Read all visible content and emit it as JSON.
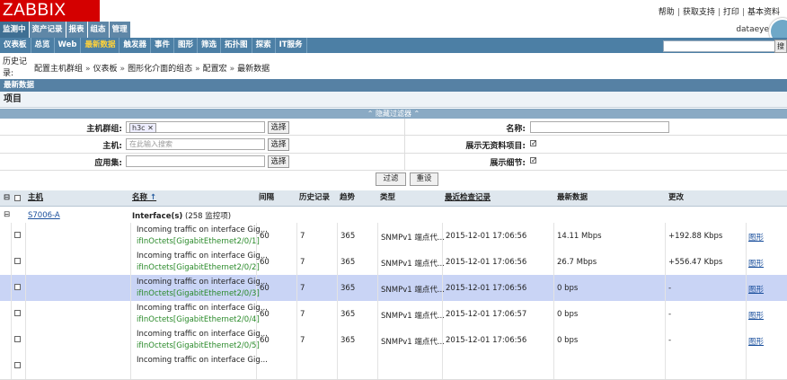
{
  "header": {
    "logo": "ZABBIX",
    "links": [
      "帮助",
      "获取支持",
      "打印",
      "基本资料"
    ],
    "user": "dataeye"
  },
  "main_tabs": [
    {
      "label": "监测中",
      "active": true
    },
    {
      "label": "资产记录"
    },
    {
      "label": "报表"
    },
    {
      "label": "组态"
    },
    {
      "label": "管理"
    }
  ],
  "sub_tabs": [
    {
      "label": "仪表板"
    },
    {
      "label": "总览"
    },
    {
      "label": "Web"
    },
    {
      "label": "最新数据",
      "active": true
    },
    {
      "label": "触发器"
    },
    {
      "label": "事件"
    },
    {
      "label": "图形"
    },
    {
      "label": "筛选"
    },
    {
      "label": "拓扑图"
    },
    {
      "label": "探索"
    },
    {
      "label": "IT服务"
    }
  ],
  "search": {
    "button": "搜"
  },
  "history": {
    "label": "历史记录:",
    "crumbs": [
      "配置主机群组",
      "仪表板",
      "图形化介面的组态",
      "配置宏",
      "最新数据"
    ]
  },
  "section_title": "最新数据",
  "items_title": "项目",
  "filter": {
    "toggle_label": "隐藏过滤器",
    "host_group_label": "主机群组:",
    "host_group_tag": "h3c",
    "host_label": "主机:",
    "host_placeholder": "在此输入搜索",
    "app_label": "应用集:",
    "select_btn": "选择",
    "name_label": "名称:",
    "show_no_data_label": "展示无资料项目:",
    "show_details_label": "展示细节:",
    "filter_btn": "过滤",
    "reset_btn": "重设"
  },
  "table": {
    "columns": [
      "主机",
      "名称",
      "间隔",
      "历史记录",
      "趋势",
      "类型",
      "最近检查记录",
      "最新数据",
      "更改"
    ],
    "sort_arrow": "↑",
    "group_host": "S7006-A",
    "group_name": "Interface(s)",
    "group_count": "(258 监控项)",
    "rows": [
      {
        "name": "Incoming traffic on interface Gig...",
        "key": "ifInOctets[GigabitEthernet2/0/1]",
        "interval": "60",
        "history": "7",
        "trends": "365",
        "type": "SNMPv1 端点代...",
        "last_check": "2015-12-01 17:06:56",
        "last_value": "14.11 Mbps",
        "change": "+192.88 Kbps",
        "graph": "图形"
      },
      {
        "name": "Incoming traffic on interface Gig...",
        "key": "ifInOctets[GigabitEthernet2/0/2]",
        "interval": "60",
        "history": "7",
        "trends": "365",
        "type": "SNMPv1 端点代...",
        "last_check": "2015-12-01 17:06:56",
        "last_value": "26.7 Mbps",
        "change": "+556.47 Kbps",
        "graph": "图形"
      },
      {
        "name": "Incoming traffic on interface Gig...",
        "key": "ifInOctets[GigabitEthernet2/0/3]",
        "interval": "60",
        "history": "7",
        "trends": "365",
        "type": "SNMPv1 端点代...",
        "last_check": "2015-12-01 17:06:56",
        "last_value": "0 bps",
        "change": "-",
        "graph": "图形",
        "selected": true
      },
      {
        "name": "Incoming traffic on interface Gig...",
        "key": "ifInOctets[GigabitEthernet2/0/4]",
        "interval": "60",
        "history": "7",
        "trends": "365",
        "type": "SNMPv1 端点代...",
        "last_check": "2015-12-01 17:06:57",
        "last_value": "0 bps",
        "change": "-",
        "graph": "图形"
      },
      {
        "name": "Incoming traffic on interface Gig...",
        "key": "ifInOctets[GigabitEthernet2/0/5]",
        "interval": "60",
        "history": "7",
        "trends": "365",
        "type": "SNMPv1 端点代...",
        "last_check": "2015-12-01 17:06:56",
        "last_value": "0 bps",
        "change": "-",
        "graph": "图形"
      },
      {
        "name": "Incoming traffic on interface Gig...",
        "key": "",
        "interval": "",
        "history": "",
        "trends": "",
        "type": "",
        "last_check": "",
        "last_value": "",
        "change": "",
        "graph": ""
      }
    ]
  }
}
